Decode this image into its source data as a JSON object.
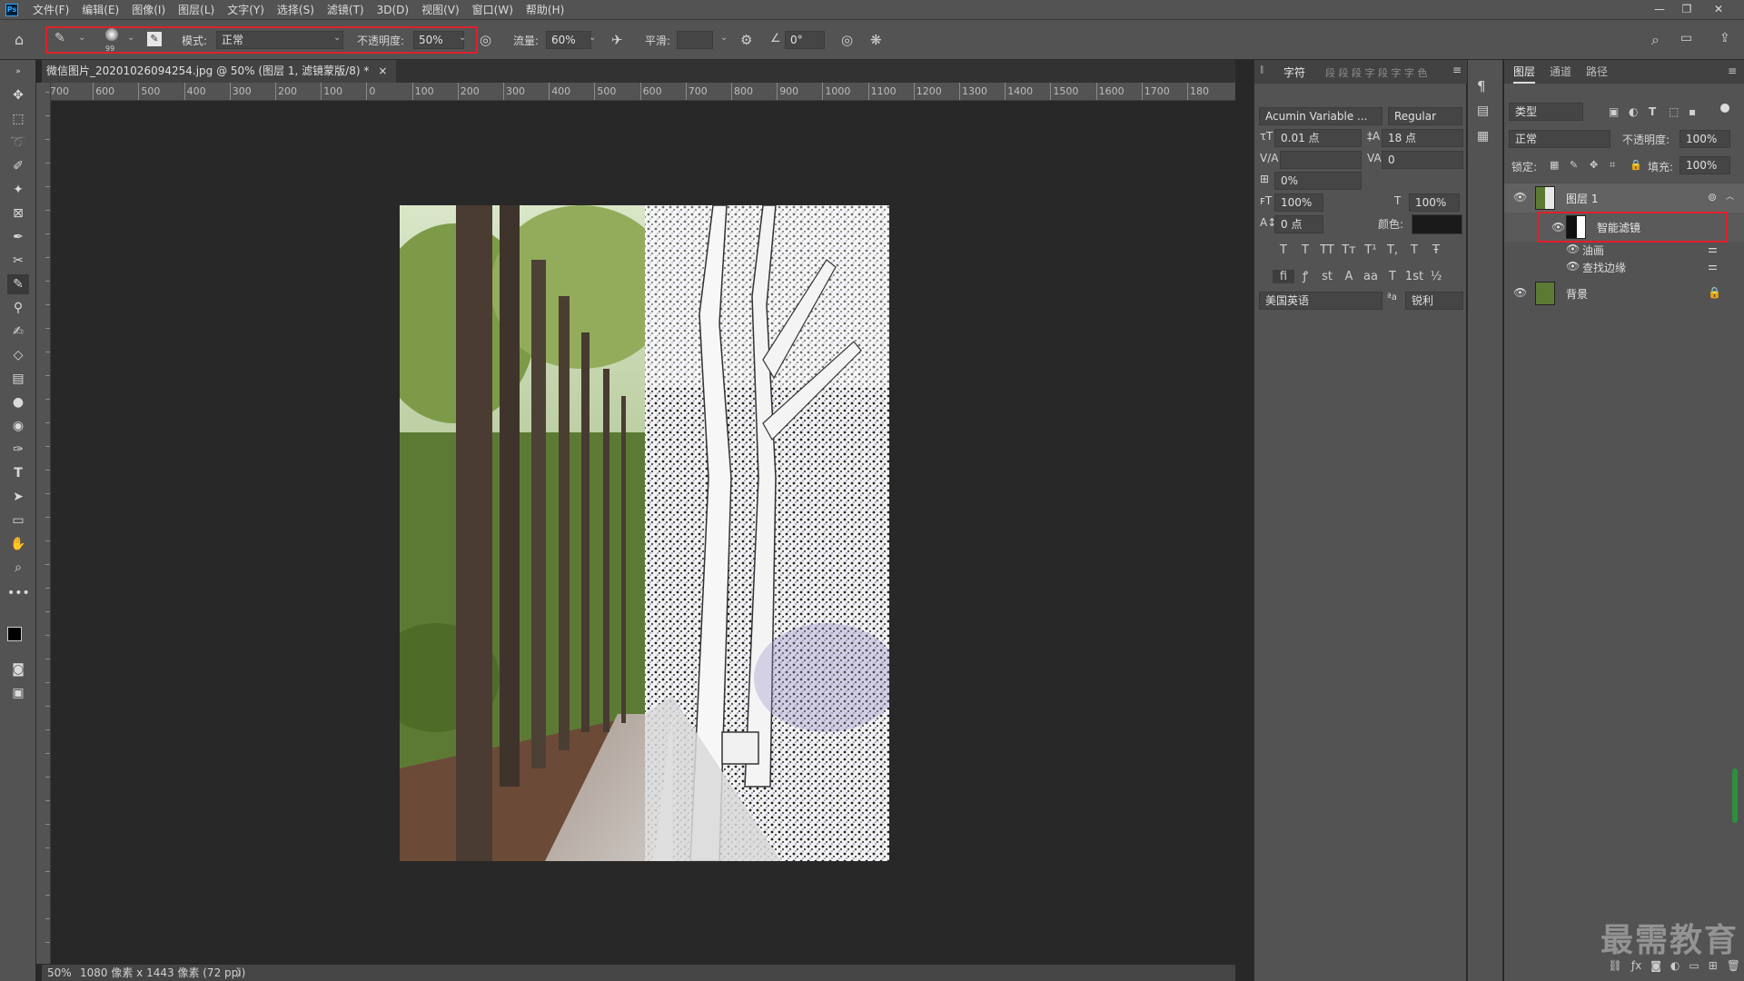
{
  "app": {
    "logo": "Ps"
  },
  "menu": [
    "文件(F)",
    "编辑(E)",
    "图像(I)",
    "图层(L)",
    "文字(Y)",
    "选择(S)",
    "滤镜(T)",
    "3D(D)",
    "视图(V)",
    "窗口(W)",
    "帮助(H)"
  ],
  "options": {
    "mode_label": "模式:",
    "mode_value": "正常",
    "opacity_label": "不透明度:",
    "opacity_value": "50%",
    "flow_label": "流量:",
    "flow_value": "60%",
    "smooth_label": "平滑:",
    "smooth_value": "",
    "angle_value": "0°",
    "brush_size": "99"
  },
  "document": {
    "tab_title": "微信图片_20201026094254.jpg @ 50% (图层 1, 滤镜蒙版/8) *",
    "close": "×"
  },
  "ruler": {
    "h_ticks": [
      "700",
      "600",
      "500",
      "400",
      "300",
      "200",
      "100",
      "0",
      "100",
      "200",
      "300",
      "400",
      "500",
      "600",
      "700",
      "800",
      "900",
      "1000",
      "1100",
      "1200",
      "1300",
      "1400",
      "1500",
      "1600",
      "1700",
      "180"
    ]
  },
  "status": {
    "zoom": "50%",
    "info": "1080 像素 x 1443 像素 (72 ppi)",
    "arrow": "〉"
  },
  "char_panel": {
    "tab": "字符",
    "inactive_tabs": "段 段 段 字 段 字 字 色",
    "font_family": "Acumin Variable ...",
    "font_style": "Regular",
    "font_size": "0.01 点",
    "leading": "18 点",
    "kerning": "",
    "tracking": "0",
    "scale_pct": "0%",
    "vscale": "100%",
    "hscale": "100%",
    "baseline": "0 点",
    "color_label": "颜色:",
    "language": "美国英语",
    "aa": "锐利",
    "glyphs1": [
      "T",
      "T",
      "TT",
      "Tт",
      "T¹",
      "T,",
      "T",
      "Ŧ"
    ],
    "glyphs2": [
      "fi",
      "ꝭ",
      "st",
      "A",
      "aa",
      "T",
      "1st",
      "½"
    ]
  },
  "layers_panel": {
    "tabs": [
      "图层",
      "通道",
      "路径"
    ],
    "kind_label": "类型",
    "blend_mode": "正常",
    "opacity_label": "不透明度:",
    "opacity_value": "100%",
    "lock_label": "锁定:",
    "fill_label": "填充:",
    "fill_value": "100%",
    "layers": [
      {
        "name": "图层 1"
      },
      {
        "name": "智能滤镜"
      },
      {
        "name": "油画"
      },
      {
        "name": "查找边缘"
      },
      {
        "name": "背景"
      }
    ]
  },
  "watermark": "最需教育",
  "colors": {
    "accent_red": "#e0202c",
    "panel": "#535353",
    "canvas": "#282828"
  }
}
